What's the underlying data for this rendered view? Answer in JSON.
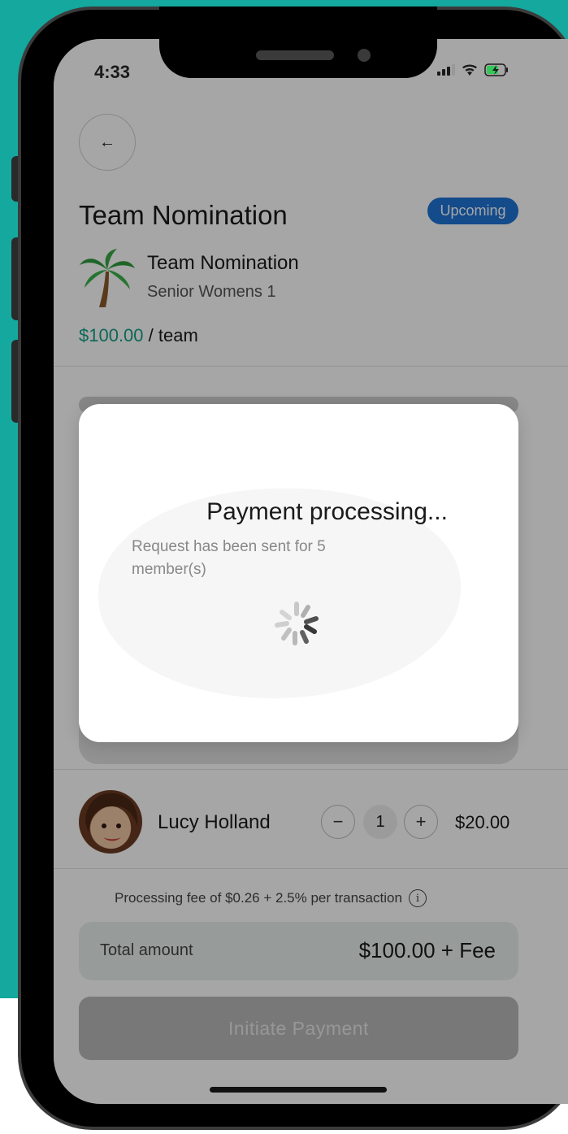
{
  "status_bar": {
    "time": "4:33"
  },
  "header": {
    "title": "Team Nomination",
    "badge": "Upcoming"
  },
  "event": {
    "name": "Team Nomination",
    "division": "Senior Womens 1",
    "price": "$100.00",
    "price_unit": "/ team"
  },
  "member": {
    "name": "Lucy Holland",
    "quantity": "1",
    "minus": "−",
    "plus": "+",
    "amount": "$20.00"
  },
  "fee_note": "Processing fee of $0.26 + 2.5% per transaction",
  "total": {
    "label": "Total amount",
    "value": "$100.00 + Fee"
  },
  "pay_button": "Initiate Payment",
  "modal": {
    "title": "Payment processing...",
    "message": "Request has been sent for 5 member(s)"
  },
  "icons": {
    "back": "arrow-left-icon",
    "info": "info-icon",
    "spinner": "loading-spinner-icon",
    "avatar": "avatar",
    "event": "palm-tree-icon"
  },
  "colors": {
    "accent": "#14a089",
    "badge": "#1f74d6",
    "background": "#14a89e"
  }
}
